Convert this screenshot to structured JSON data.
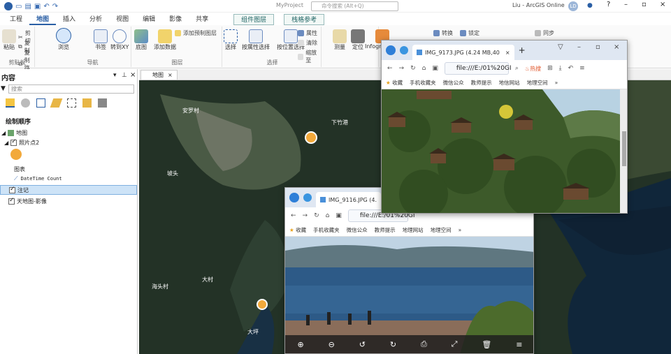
{
  "app": {
    "title": "MyProject",
    "search_placeholder": "命令搜索 (Alt+Q)",
    "user": "Liu - ArcGIS Online",
    "user_initials": "LD"
  },
  "ribbon_tabs": [
    "工程",
    "地图",
    "插入",
    "分析",
    "视图",
    "编辑",
    "影像",
    "共享"
  ],
  "context_tabs": [
    "组件图层",
    "栈格参考"
  ],
  "ribbon": {
    "clipboard": {
      "label": "剪贴板",
      "items": [
        "粘贴",
        "剪切",
        "复制",
        "复制路径"
      ]
    },
    "navigate": {
      "label": "导航",
      "items": [
        "浏览",
        "书签",
        "转到XY"
      ]
    },
    "layer": {
      "label": "图层",
      "items": [
        "底图",
        "添加数据",
        "添加预制图层"
      ]
    },
    "selection": {
      "label": "选择",
      "items": [
        "选择",
        "按属性选择",
        "按位置选择",
        "属性",
        "清除",
        "缩放至"
      ]
    },
    "inquiry": {
      "items": [
        "测量",
        "定位",
        "Infographics"
      ]
    },
    "labeling": {
      "items": [
        "转换",
        "锁定",
        "同步"
      ]
    }
  },
  "contents": {
    "title": "内容",
    "search_placeholder": "搜索",
    "drawing_order": "绘制顺序",
    "layers": [
      {
        "name": "地图",
        "level": 0,
        "checked": true
      },
      {
        "name": "照片点2",
        "level": 1,
        "checked": true
      },
      {
        "name": "图表",
        "level": 2
      },
      {
        "name": "DateTime Count",
        "level": 2
      },
      {
        "name": "注记",
        "level": 1,
        "checked": true
      },
      {
        "name": "天地图-影像",
        "level": 1,
        "checked": true
      }
    ]
  },
  "map_tab": "地图",
  "map_labels": [
    "安罗村",
    "下竹港",
    "大村",
    "大坪",
    "海头村",
    "坡头"
  ],
  "browser_back": {
    "tab_title": "IMG_9116.JPG (4.",
    "url": "file:///E:/01%20GI",
    "bookmarks": [
      "收藏",
      "手机收藏夹",
      "微信公众",
      "教师提示",
      "地理网站",
      "地理空间"
    ]
  },
  "browser_front": {
    "tab_title": "IMG_9173.JPG (4.24 MB,40",
    "url": "file:///E:/01%20GI",
    "hot": "热搜",
    "bookmarks": [
      "收藏",
      "手机收藏夹",
      "微信公众",
      "教师提示",
      "地信网站",
      "地理空间"
    ]
  },
  "viewer_toolbar": [
    "zoom-in",
    "zoom-out",
    "rotate-left",
    "rotate-right",
    "print",
    "fullscreen",
    "delete",
    "menu"
  ],
  "colors": {
    "accent": "#2a5fa5",
    "ribbon_bg": "#fafafa",
    "map_dark": "#1e2c1f",
    "selection": "#cde3f7"
  }
}
